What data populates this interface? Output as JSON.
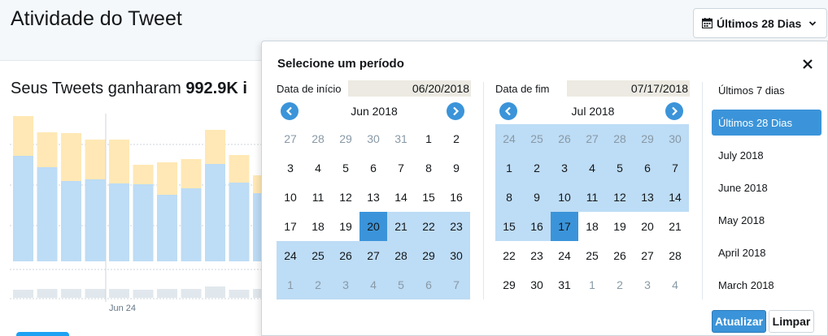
{
  "header": {
    "title": "Atividade do Tweet",
    "period_button_label": "Últimos 28 Dias"
  },
  "summary": {
    "prefix": "Seus Tweets ganharam ",
    "value": "992.9K i"
  },
  "chart_data": {
    "type": "bar",
    "stacked": true,
    "x_tick_labels": [
      "Jun 24"
    ],
    "ylim": [
      0,
      180
    ],
    "series": [
      {
        "values": [
          130,
          116,
          99,
          101,
          96,
          95,
          82,
          90,
          120,
          97,
          84
        ]
      },
      {
        "values": [
          49,
          43,
          59,
          49,
          54,
          24,
          40,
          36,
          42,
          34,
          22
        ]
      }
    ],
    "secondary_values": [
      10,
      11,
      11,
      11,
      11,
      10,
      11,
      11,
      14,
      10,
      11
    ],
    "colors": {
      "primary": "#bddcf5",
      "secondary": "#ffe8b5",
      "baseline": "#e1e8ed"
    }
  },
  "popover": {
    "title": "Selecione um período",
    "close_icon": "close-icon",
    "start": {
      "label": "Data de início",
      "value": "06/20/2018",
      "month_label": "Jun 2018",
      "days": [
        {
          "d": "27",
          "o": true
        },
        {
          "d": "28",
          "o": true
        },
        {
          "d": "29",
          "o": true
        },
        {
          "d": "30",
          "o": true
        },
        {
          "d": "31",
          "o": true
        },
        {
          "d": "1"
        },
        {
          "d": "2"
        },
        {
          "d": "3"
        },
        {
          "d": "4"
        },
        {
          "d": "5"
        },
        {
          "d": "6"
        },
        {
          "d": "7"
        },
        {
          "d": "8"
        },
        {
          "d": "9"
        },
        {
          "d": "10"
        },
        {
          "d": "11"
        },
        {
          "d": "12"
        },
        {
          "d": "13"
        },
        {
          "d": "14"
        },
        {
          "d": "15"
        },
        {
          "d": "16"
        },
        {
          "d": "17"
        },
        {
          "d": "18"
        },
        {
          "d": "19"
        },
        {
          "d": "20",
          "a": true
        },
        {
          "d": "21",
          "r": true
        },
        {
          "d": "22",
          "r": true
        },
        {
          "d": "23",
          "r": true
        },
        {
          "d": "24",
          "r": true
        },
        {
          "d": "25",
          "r": true
        },
        {
          "d": "26",
          "r": true
        },
        {
          "d": "27",
          "r": true
        },
        {
          "d": "28",
          "r": true
        },
        {
          "d": "29",
          "r": true
        },
        {
          "d": "30",
          "r": true
        },
        {
          "d": "1",
          "o": true,
          "r": true
        },
        {
          "d": "2",
          "o": true,
          "r": true
        },
        {
          "d": "3",
          "o": true,
          "r": true
        },
        {
          "d": "4",
          "o": true,
          "r": true
        },
        {
          "d": "5",
          "o": true,
          "r": true
        },
        {
          "d": "6",
          "o": true,
          "r": true
        },
        {
          "d": "7",
          "o": true,
          "r": true
        }
      ]
    },
    "end": {
      "label": "Data de fim",
      "value": "07/17/2018",
      "month_label": "Jul 2018",
      "days": [
        {
          "d": "24",
          "o": true,
          "r": true
        },
        {
          "d": "25",
          "o": true,
          "r": true
        },
        {
          "d": "26",
          "o": true,
          "r": true
        },
        {
          "d": "27",
          "o": true,
          "r": true
        },
        {
          "d": "28",
          "o": true,
          "r": true
        },
        {
          "d": "29",
          "o": true,
          "r": true
        },
        {
          "d": "30",
          "o": true,
          "r": true
        },
        {
          "d": "1",
          "r": true
        },
        {
          "d": "2",
          "r": true
        },
        {
          "d": "3",
          "r": true
        },
        {
          "d": "4",
          "r": true
        },
        {
          "d": "5",
          "r": true
        },
        {
          "d": "6",
          "r": true
        },
        {
          "d": "7",
          "r": true
        },
        {
          "d": "8",
          "r": true
        },
        {
          "d": "9",
          "r": true
        },
        {
          "d": "10",
          "r": true
        },
        {
          "d": "11",
          "r": true
        },
        {
          "d": "12",
          "r": true
        },
        {
          "d": "13",
          "r": true
        },
        {
          "d": "14",
          "r": true
        },
        {
          "d": "15",
          "r": true
        },
        {
          "d": "16",
          "r": true
        },
        {
          "d": "17",
          "a": true
        },
        {
          "d": "18"
        },
        {
          "d": "19"
        },
        {
          "d": "20"
        },
        {
          "d": "21"
        },
        {
          "d": "22"
        },
        {
          "d": "23"
        },
        {
          "d": "24"
        },
        {
          "d": "25"
        },
        {
          "d": "26"
        },
        {
          "d": "27"
        },
        {
          "d": "28"
        },
        {
          "d": "29"
        },
        {
          "d": "30"
        },
        {
          "d": "31"
        },
        {
          "d": "1",
          "o": true
        },
        {
          "d": "2",
          "o": true
        },
        {
          "d": "3",
          "o": true
        },
        {
          "d": "4",
          "o": true
        }
      ]
    },
    "presets": [
      {
        "label": "Últimos 7 dias",
        "selected": false
      },
      {
        "label": "Últimos 28 Dias",
        "selected": true
      },
      {
        "label": "July 2018",
        "selected": false
      },
      {
        "label": "June 2018",
        "selected": false
      },
      {
        "label": "May 2018",
        "selected": false
      },
      {
        "label": "April 2018",
        "selected": false
      },
      {
        "label": "March 2018",
        "selected": false
      }
    ],
    "apply_label": "Atualizar",
    "clear_label": "Limpar"
  },
  "colors": {
    "accent": "#3b94d9",
    "range": "#bddcf5",
    "muted_day": "#8899a6",
    "input_bg": "#eceae2"
  }
}
